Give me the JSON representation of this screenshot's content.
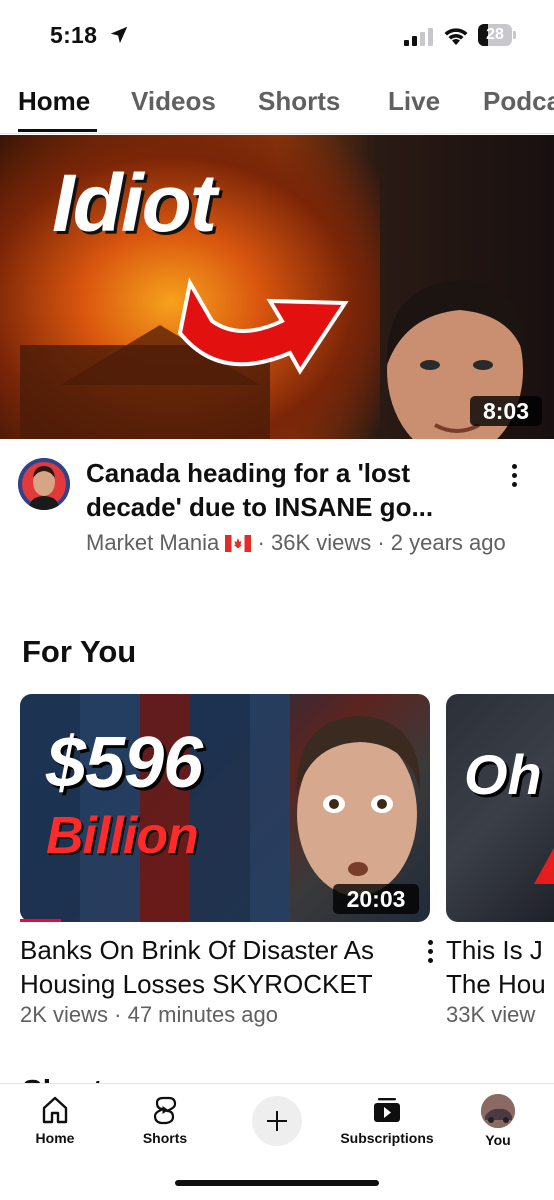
{
  "status_bar": {
    "time": "5:18",
    "battery": "28",
    "battery_level": 0.28,
    "icons": [
      "location-arrow-icon",
      "signal-icon",
      "wifi-icon",
      "battery-icon"
    ]
  },
  "tabs": [
    {
      "label": "Home",
      "active": true
    },
    {
      "label": "Videos",
      "active": false
    },
    {
      "label": "Shorts",
      "active": false
    },
    {
      "label": "Live",
      "active": false
    },
    {
      "label": "Podcasts",
      "active": false
    }
  ],
  "main_video": {
    "thumbnail_text": "Idiot",
    "duration": "8:03",
    "title": "Canada heading for a 'lost decade' due to INSANE go...",
    "channel": "Market Mania",
    "stats": "· 36K views · 2 years ago"
  },
  "for_you": {
    "heading": "For You",
    "cards": [
      {
        "thumbnail_big_text": "$596",
        "thumbnail_sub_text": "Billion",
        "duration": "20:03",
        "title_line1": "Banks On Brink Of Disaster As",
        "title_line2": "Housing Losses SKYROCKET",
        "meta": "2K views · 47 minutes ago",
        "watch_progress": 0.1
      },
      {
        "thumbnail_big_text": "Oh",
        "title_line1": "This Is J",
        "title_line2": "The Hou",
        "meta": "33K view"
      }
    ]
  },
  "next_section_peek": "Shorts",
  "bottom_nav": {
    "home": "Home",
    "shorts": "Shorts",
    "create_icon": "plus-icon",
    "subscriptions": "Subscriptions",
    "you": "You"
  },
  "colors": {
    "accent_red": "#ff0033",
    "text_primary": "#0f0f0f",
    "text_secondary": "#606060"
  }
}
